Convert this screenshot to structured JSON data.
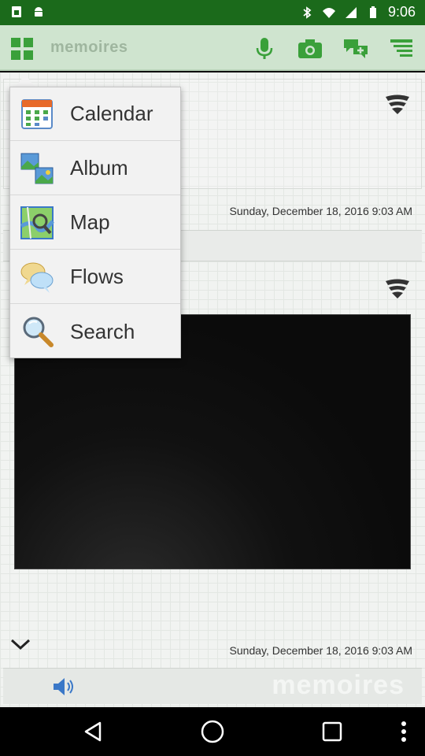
{
  "status_bar": {
    "time": "9:06",
    "icons": [
      "sim-icon",
      "android-icon",
      "bluetooth-icon",
      "wifi-icon",
      "signal-icon",
      "battery-icon"
    ]
  },
  "app_bar": {
    "title": "memoires",
    "actions": [
      "microphone-icon",
      "camera-icon",
      "add-flow-icon",
      "menu-list-icon"
    ]
  },
  "menu": {
    "items": [
      {
        "label": "Calendar",
        "icon": "calendar-icon"
      },
      {
        "label": "Album",
        "icon": "album-icon"
      },
      {
        "label": "Map",
        "icon": "map-icon"
      },
      {
        "label": "Flows",
        "icon": "flows-icon"
      },
      {
        "label": "Search",
        "icon": "search-icon"
      }
    ]
  },
  "entries": [
    {
      "timestamp": "Sunday, December 18, 2016 9:03 AM"
    },
    {
      "timestamp": "Sunday, December 18, 2016 9:03 AM"
    }
  ],
  "bottom_bar": {
    "watermark": "memoires"
  },
  "colors": {
    "status_bar": "#1b6a1b",
    "app_bar": "#cfe4cf",
    "accent_icon": "#3aa03a"
  }
}
